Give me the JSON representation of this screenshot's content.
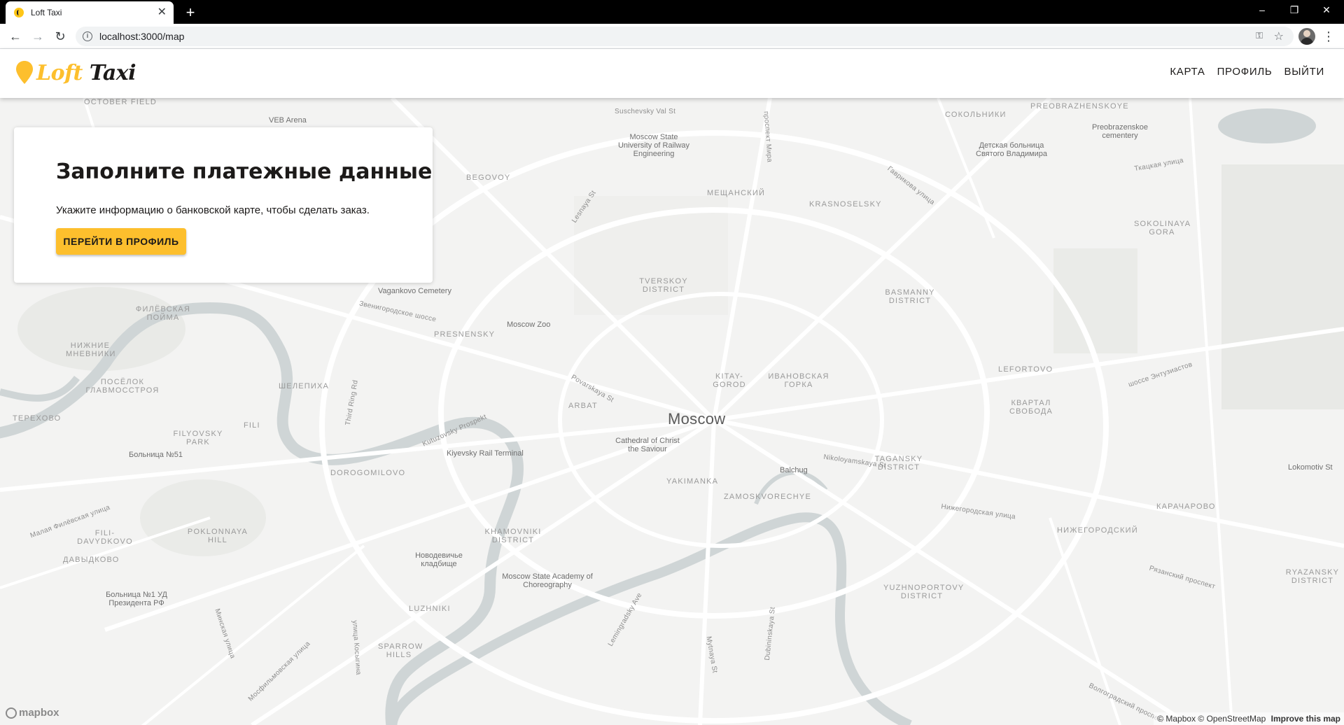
{
  "browser": {
    "tab_title": "Loft Taxi",
    "tab_close": "✕",
    "new_tab": "+",
    "url": "localhost:3000/map",
    "window_controls": {
      "minimize": "–",
      "restore": "❐",
      "close": "✕"
    },
    "nav": {
      "back": "←",
      "forward": "→",
      "reload": "↻"
    },
    "icons": {
      "star": "☆",
      "key": "⚿",
      "menu": "⋮",
      "info": "i"
    }
  },
  "header": {
    "logo_loft": "Loft",
    "logo_taxi": "Taxi",
    "nav": [
      "КАРТА",
      "ПРОФИЛЬ",
      "ВЫЙТИ"
    ]
  },
  "card": {
    "title": "Заполните платежные данные",
    "text": "Укажите информацию о банковской карте, чтобы сделать заказ.",
    "button": "ПЕРЕЙТИ В ПРОФИЛЬ"
  },
  "map": {
    "city": "Moscow",
    "labels": [
      "OCTOBER FIELD",
      "VEB Arena",
      "Suschevsky Val St",
      "Moscow State University of Railway Engineering",
      "СОКОЛЬНИКИ",
      "PREOBRAZHENSKOYE",
      "Preobrazenskoe cementery",
      "Детская больница Святого Владимира",
      "BEGOVOY",
      "МЕЩАНСКИЙ",
      "KRASNOSELSKY",
      "SOKOLINAYA GORA",
      "Vagankovo Cemetery",
      "TVERSKOY DISTRICT",
      "BASMANNY DISTRICT",
      "ФИЛЁВСКАЯ ПОЙМА",
      "PRESNENSKY",
      "Moscow Zoo",
      "НИЖНИЕ МНЕВНИКИ",
      "ПОСЁЛОК ГЛАВМОССТРОЯ",
      "ШЕЛЕПИХА",
      "KITAY-GOROD",
      "ИВАНОВСКАЯ ГОРКА",
      "LEFORTOVO",
      "ТЕРЕХОВО",
      "ARBAT",
      "КВАРТАЛ СВОБОДА",
      "FILYOVSKY PARK",
      "FILI",
      "Kiyevsky Rail Terminal",
      "Cathedral of Christ the Saviour",
      "Больница №51",
      "Balchug",
      "TAGANSKY DISTRICT",
      "DOROGOMILOVO",
      "YAKIMANKA",
      "ZAMOSKVORECHYE",
      "FILI-DAVYDKOVO",
      "POKLONNAYA HILL",
      "KHAMOVNIKI DISTRICT",
      "КАРАЧАРОВО",
      "НИЖЕГОРОДСКИЙ",
      "ДАВЫДКОВО",
      "Новодевичье кладбище",
      "Moscow State Academy of Choreography",
      "RYAZANSKY DISTRICT",
      "Больница №1 УД Президента РФ",
      "YUZHNOPORTOVY DISTRICT",
      "LUZHNIKI",
      "SPARROW HILLS",
      "Lokomotiv St"
    ],
    "roads": [
      "Kutuzovsky Prospekt",
      "Third Ring Rd",
      "Nikoloyamskaya St",
      "Нижегородская улица",
      "Звенигородское шоссе",
      "Povarskaya St",
      "шоссе Энтузиастов",
      "Рязанский проспект",
      "Малая Филёвская улица",
      "Lesnaya St",
      "проспект Мира",
      "Гавриковa улица",
      "Ткацкая улица",
      "Lemingradsky Ave",
      "Mytnaya St",
      "Dubininskaya St",
      "Волгоградский проспект",
      "улица Косыгина",
      "Мосфильмовская улица",
      "Минская улица"
    ],
    "attribution": "© Mapbox © OpenStreetMap",
    "improve": "Improve this map",
    "mapbox_brand": "mapbox"
  },
  "colors": {
    "accent": "#fdbf2d",
    "text_dark": "#1c1a19",
    "map_bg": "#f3f3f2",
    "water": "#cfd5d6",
    "road": "#ffffff",
    "park": "#e8e9e6"
  }
}
